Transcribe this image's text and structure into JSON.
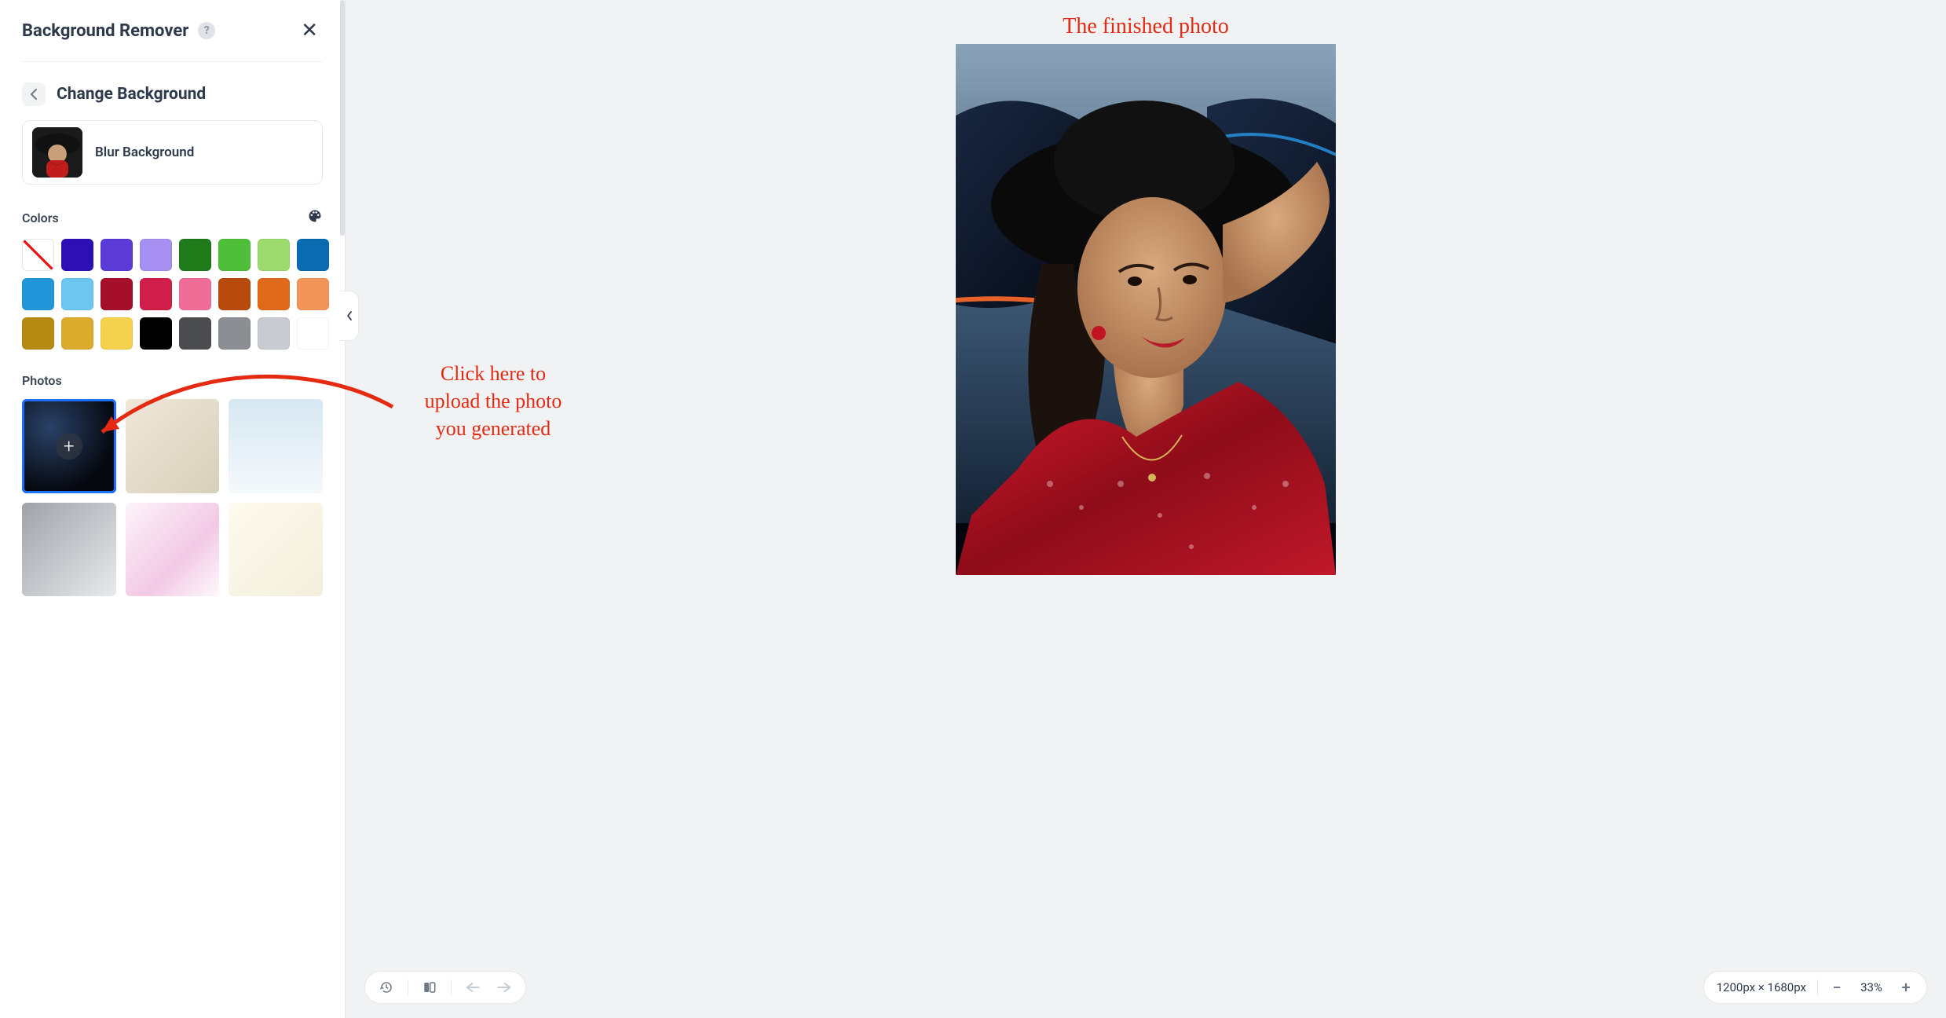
{
  "panel": {
    "title": "Background Remover",
    "section_title": "Change Background",
    "blur_label": "Blur Background",
    "colors_label": "Colors",
    "photos_label": "Photos"
  },
  "colors": [
    {
      "name": "none",
      "hex": "none"
    },
    {
      "name": "indigo",
      "hex": "#2e0fb5"
    },
    {
      "name": "violet",
      "hex": "#5a3bd6"
    },
    {
      "name": "lavender",
      "hex": "#a58ff0"
    },
    {
      "name": "forest-green",
      "hex": "#1f7a1a"
    },
    {
      "name": "green",
      "hex": "#4fbf3a"
    },
    {
      "name": "light-green",
      "hex": "#9ddb6f"
    },
    {
      "name": "blue",
      "hex": "#0a6bb0"
    },
    {
      "name": "sky-blue",
      "hex": "#2196d9"
    },
    {
      "name": "light-blue",
      "hex": "#6cc6ef"
    },
    {
      "name": "maroon",
      "hex": "#a50f2a"
    },
    {
      "name": "crimson",
      "hex": "#d01e4a"
    },
    {
      "name": "pink",
      "hex": "#ef6d97"
    },
    {
      "name": "rust",
      "hex": "#b84a0e"
    },
    {
      "name": "orange",
      "hex": "#e06a1b"
    },
    {
      "name": "peach",
      "hex": "#f2955a"
    },
    {
      "name": "olive-gold",
      "hex": "#b58a12"
    },
    {
      "name": "gold",
      "hex": "#dbab2e"
    },
    {
      "name": "yellow",
      "hex": "#f4d24e"
    },
    {
      "name": "black",
      "hex": "#000000"
    },
    {
      "name": "dark-gray",
      "hex": "#4a4c4f"
    },
    {
      "name": "gray",
      "hex": "#8b8e92"
    },
    {
      "name": "light-gray",
      "hex": "#c8cbcf"
    },
    {
      "name": "white",
      "hex": "#ffffff"
    }
  ],
  "photos": [
    {
      "name": "uploaded-scifi-car",
      "selected": true,
      "has_upload_badge": true
    },
    {
      "name": "beige-paper",
      "selected": false
    },
    {
      "name": "pale-sky-gradient",
      "selected": false
    },
    {
      "name": "gray-gradient",
      "selected": false
    },
    {
      "name": "pink-gradient",
      "selected": false
    },
    {
      "name": "cream-gradient",
      "selected": false
    }
  ],
  "annotation": {
    "hero": "The finished photo",
    "callout_line1": "Click here to",
    "callout_line2": "upload the photo",
    "callout_line3": "you generated"
  },
  "zoom": {
    "dimensions": "1200px × 1680px",
    "level": "33%"
  }
}
